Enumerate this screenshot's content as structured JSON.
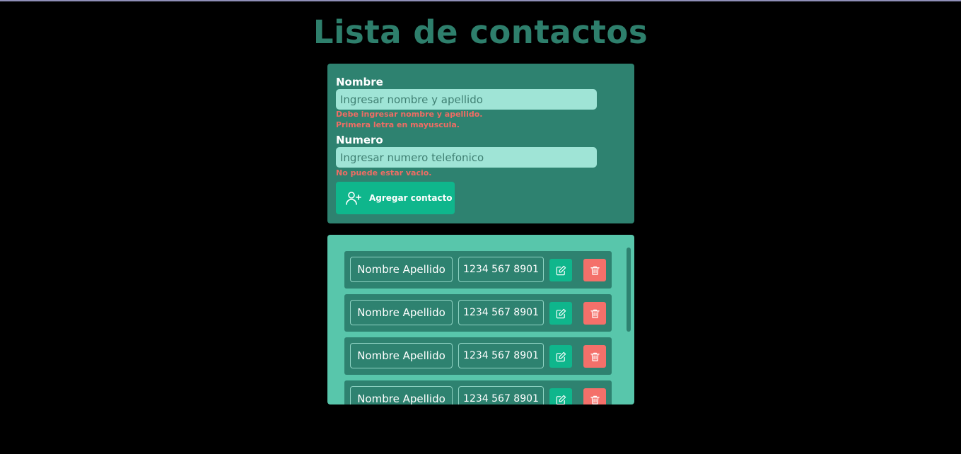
{
  "page_title": "Lista de contactos",
  "form": {
    "name_label": "Nombre",
    "name_placeholder": "Ingresar nombre y apellido",
    "name_value": "",
    "name_error_1": "Debe ingresar nombre y apellido.",
    "name_error_2": "Primera letra en mayuscula.",
    "number_label": "Numero",
    "number_placeholder": "Ingresar numero telefonico",
    "number_value": "",
    "number_error": "No puede estar vacio.",
    "add_button_label": "Agregar contacto",
    "add_button_icon": "user-plus-icon"
  },
  "contacts": [
    {
      "name": "Nombre Apellido",
      "number": "1234 567 8901"
    },
    {
      "name": "Nombre Apellido",
      "number": "1234 567 8901"
    },
    {
      "name": "Nombre Apellido",
      "number": "1234 567 8901"
    },
    {
      "name": "Nombre Apellido",
      "number": "1234 567 8901"
    }
  ],
  "row_icons": {
    "edit": "edit-icon",
    "delete": "trash-icon"
  },
  "colors": {
    "background": "#000000",
    "title": "#2e7f6c",
    "form_card": "#2e8270",
    "list_card": "#58c6ab",
    "input": "#9fe4d6",
    "error": "#ef6d64",
    "primary_button": "#0fb68c",
    "delete_button": "#f4706a"
  }
}
